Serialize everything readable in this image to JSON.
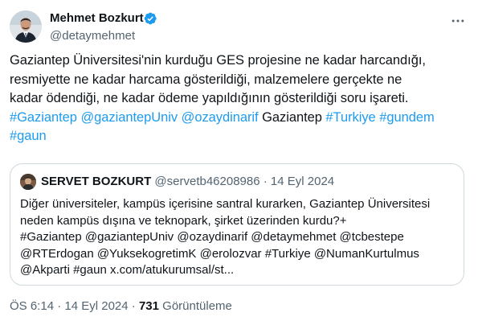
{
  "author": {
    "display_name": "Mehmet Bozkurt",
    "username": "@detaymehmet",
    "verified": true
  },
  "tweet": {
    "lines": [
      [
        {
          "text": "Gaziantep Üniversitesi'nin kurduğu GES projesine ne kadar harcandığı,",
          "link": false
        }
      ],
      [
        {
          "text": "resmiyette ne kadar harcama gösterildiği, malzemelere gerçekte ne",
          "link": false
        }
      ],
      [
        {
          "text": "kadar ödendiği, ne kadar ödeme yapıldığının gösterildiği soru işareti.",
          "link": false
        }
      ],
      [
        {
          "text": "#Gaziantep",
          "link": true
        },
        {
          "text": " ",
          "link": false
        },
        {
          "text": "@gaziantepUniv",
          "link": true
        },
        {
          "text": " ",
          "link": false
        },
        {
          "text": "@ozaydinarif",
          "link": true
        },
        {
          "text": " Gaziantep ",
          "link": false
        },
        {
          "text": "#Turkiye",
          "link": true
        },
        {
          "text": " ",
          "link": false
        },
        {
          "text": "#gundem",
          "link": true
        }
      ],
      [
        {
          "text": "#gaun",
          "link": true
        }
      ]
    ]
  },
  "quote": {
    "display_name": "SERVET BOZKURT",
    "username": "@servetb46208986",
    "separator": "·",
    "date": "14 Eyl 2024",
    "lines": [
      "Diğer üniversiteler, kampüs içerisine santral kurarken, Gaziantep Üniversitesi",
      "neden kampüs dışına ve teknopark, şirket üzerinden kurdu?+",
      "#Gaziantep @gaziantepUniv @ozaydinarif @detaymehmet @tcbestepe",
      "@RTErdogan @YuksekogretimK @erolozvar #Turkiye @NumanKurtulmus",
      "@Akparti  #gaun x.com/atukurumsal/st..."
    ]
  },
  "meta": {
    "time": "ÖS 6:14",
    "separator": "·",
    "date": "14 Eyl 2024",
    "views_count": "731",
    "views_label": "Görüntüleme"
  },
  "colors": {
    "link": "#1d9bf0",
    "text": "#0f1419",
    "secondary": "#536471",
    "border": "#cfd9de",
    "verified": "#1d9bf0"
  },
  "icons": {
    "verified": "verified-badge-icon",
    "more": "more-horizontal-icon"
  }
}
